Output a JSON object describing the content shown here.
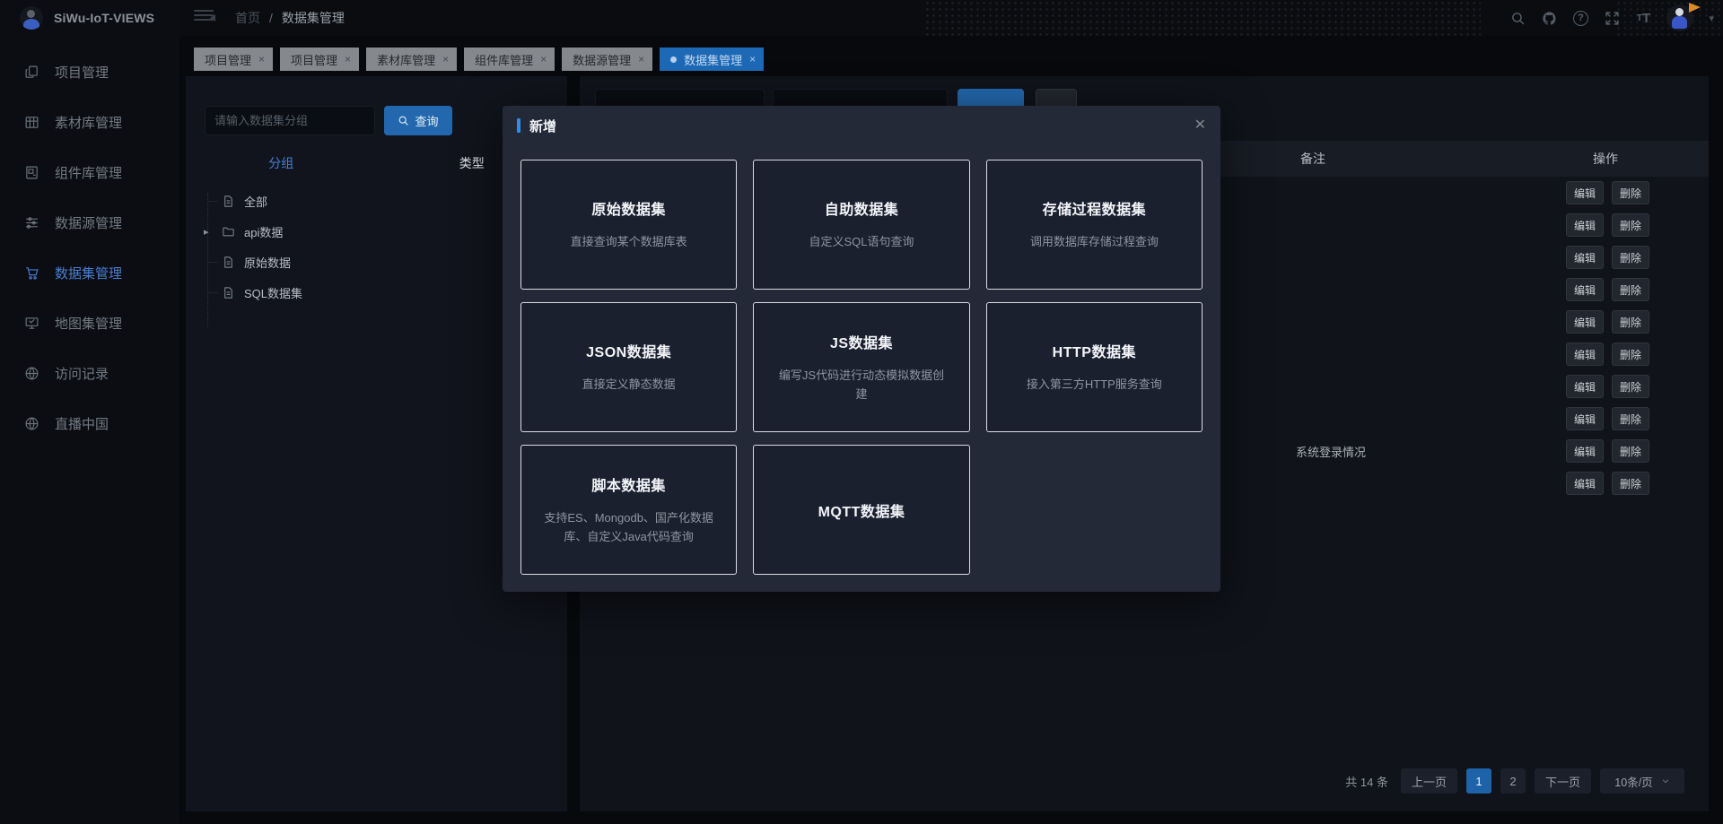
{
  "app": {
    "title": "SiWu-IoT-VIEWS"
  },
  "header": {
    "breadcrumb": {
      "home": "首页",
      "separator": "/",
      "current": "数据集管理"
    },
    "icons": [
      "menu-fold",
      "search",
      "github",
      "help",
      "fullscreen",
      "font-size",
      "user-avatar",
      "caret-down"
    ]
  },
  "tabs": {
    "close_glyph": "×",
    "items": [
      {
        "label": "项目管理",
        "active": false
      },
      {
        "label": "项目管理",
        "active": false
      },
      {
        "label": "素材库管理",
        "active": false
      },
      {
        "label": "组件库管理",
        "active": false
      },
      {
        "label": "数据源管理",
        "active": false
      },
      {
        "label": "数据集管理",
        "active": true
      }
    ]
  },
  "sidebar": {
    "items": [
      {
        "label": "项目管理",
        "icon": "copy-icon",
        "active": false
      },
      {
        "label": "素材库管理",
        "icon": "table-icon",
        "active": false
      },
      {
        "label": "组件库管理",
        "icon": "component-icon",
        "active": false
      },
      {
        "label": "数据源管理",
        "icon": "sliders-icon",
        "active": false
      },
      {
        "label": "数据集管理",
        "icon": "cart-icon",
        "active": true
      },
      {
        "label": "地图集管理",
        "icon": "presentation-icon",
        "active": false
      },
      {
        "label": "访问记录",
        "icon": "globe-icon",
        "active": false
      },
      {
        "label": "直播中国",
        "icon": "globe-icon",
        "active": false
      }
    ]
  },
  "tree_panel": {
    "search": {
      "value": "",
      "placeholder": "请输入数据集分组"
    },
    "query_button": "查询",
    "tabs": {
      "group": "分组",
      "type": "类型"
    },
    "nodes": [
      {
        "label": "全部",
        "icon": "file-icon"
      },
      {
        "label": "api数据",
        "icon": "folder-icon",
        "caret": "▸"
      },
      {
        "label": "原始数据",
        "icon": "file-icon"
      },
      {
        "label": "SQL数据集",
        "icon": "file-icon"
      }
    ]
  },
  "main": {
    "table": {
      "headers": {
        "remark": "备注",
        "action": "操作"
      },
      "actions": {
        "edit": "编辑",
        "delete": "删除"
      },
      "rows": [
        {
          "remark": ""
        },
        {
          "remark": ""
        },
        {
          "remark": ""
        },
        {
          "remark": ""
        },
        {
          "remark": ""
        },
        {
          "remark": ""
        },
        {
          "remark": ""
        },
        {
          "remark": ""
        },
        {
          "remark": "系统登录情况"
        },
        {
          "remark": ""
        }
      ]
    },
    "pagination": {
      "total": "共 14 条",
      "prev": "上一页",
      "pages": [
        "1",
        "2"
      ],
      "active_page": "1",
      "next": "下一页",
      "page_size": "10条/页"
    }
  },
  "modal": {
    "title": "新增",
    "close_glyph": "✕",
    "cards": [
      {
        "title": "原始数据集",
        "desc": "直接查询某个数据库表"
      },
      {
        "title": "自助数据集",
        "desc": "自定义SQL语句查询"
      },
      {
        "title": "存储过程数据集",
        "desc": "调用数据库存储过程查询"
      },
      {
        "title": "JSON数据集",
        "desc": "直接定义静态数据"
      },
      {
        "title": "JS数据集",
        "desc": "编写JS代码进行动态模拟数据创建"
      },
      {
        "title": "HTTP数据集",
        "desc": "接入第三方HTTP服务查询"
      },
      {
        "title": "脚本数据集",
        "desc": "支持ES、Mongodb、国产化数据库、自定义Java代码查询"
      },
      {
        "title": "MQTT数据集",
        "desc": ""
      }
    ]
  },
  "colors": {
    "active_tab": "#1d69b6",
    "primary_button": "#2368ae",
    "link_blue": "#4a7fd4",
    "modal_accent": "#2d8cf0",
    "modal_bg": "#232936",
    "panel_bg": "#11141c"
  }
}
